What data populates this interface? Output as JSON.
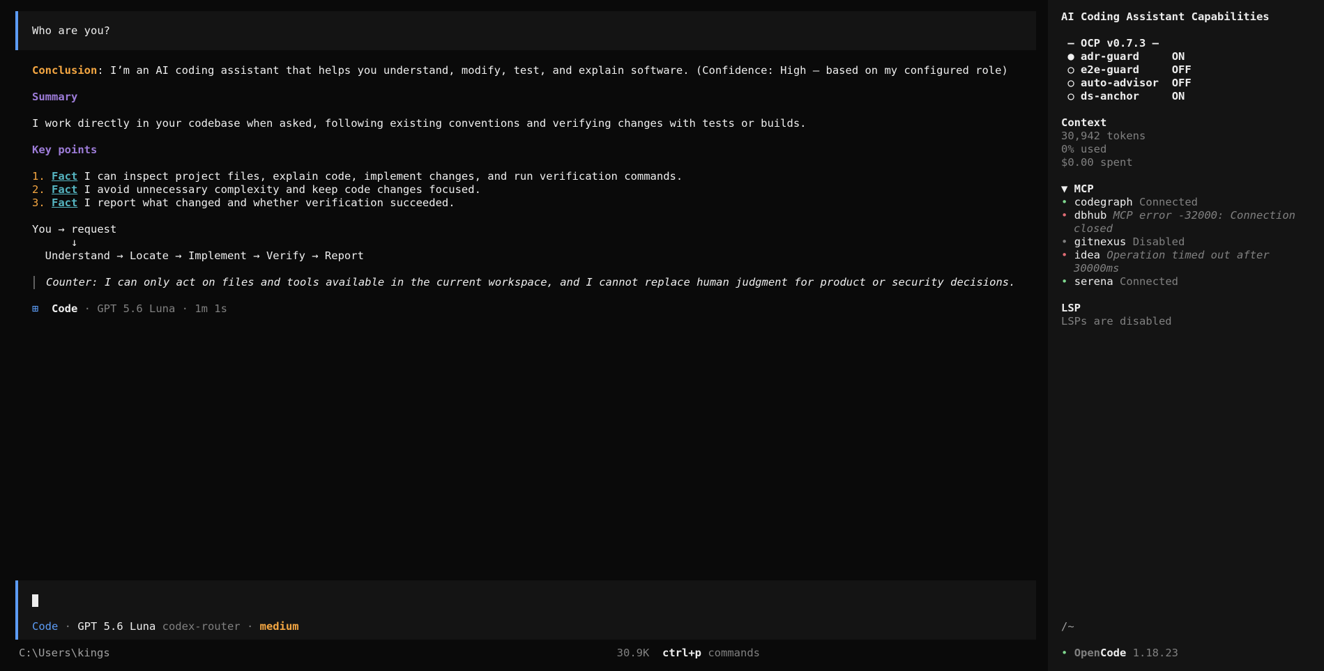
{
  "user_message": "Who are you?",
  "response": {
    "conclusion_label": "Conclusion",
    "conclusion_text": ": I’m an AI coding assistant that helps you understand, modify, test, and explain software. (Confidence: High — based on my configured role)",
    "summary_heading": "Summary",
    "summary_text": "I work directly in your codebase when asked, following existing conventions and verifying changes with tests or builds.",
    "key_points_heading": "Key points",
    "points": [
      {
        "num": "1.",
        "tag": "Fact",
        "text": " I can inspect project files, explain code, implement changes, and run verification commands."
      },
      {
        "num": "2.",
        "tag": "Fact",
        "text": " I avoid unnecessary complexity and keep code changes focused."
      },
      {
        "num": "3.",
        "tag": "Fact",
        "text": " I report what changed and whether verification succeeded."
      }
    ],
    "flow_line1": "You → request",
    "flow_line2": "      ↓",
    "flow_line3": "  Understand → Locate → Implement → Verify → Report",
    "counter": "Counter: I can only act on files and tools available in the current workspace, and I cannot replace human judgment for product or security decisions.",
    "meta_icon": "⊞",
    "meta_mode": "Code",
    "meta_detail": " · GPT 5.6 Luna · 1m 1s"
  },
  "prompt": {
    "mode": "Code",
    "sep1": " · ",
    "model": "GPT 5.6 Luna",
    "provider": " codex-router",
    "sep2": " · ",
    "effort": "medium"
  },
  "footer": {
    "path": "C:\\Users\\kings",
    "tokens": "30.9K",
    "shortcut": "ctrl+p",
    "shortcut_label": " commands"
  },
  "sidebar": {
    "title": "AI Coding Assistant Capabilities",
    "ocp_header": " — OCP v0.7.3 —",
    "ocp_items": [
      {
        "bullet": "●",
        "name": "adr-guard     ",
        "state": "ON"
      },
      {
        "bullet": "○",
        "name": "e2e-guard     ",
        "state": "OFF"
      },
      {
        "bullet": "○",
        "name": "auto-advisor  ",
        "state": "OFF"
      },
      {
        "bullet": "○",
        "name": "ds-anchor     ",
        "state": "ON"
      }
    ],
    "context_heading": "Context",
    "context_tokens": "30,942 tokens",
    "context_used": "0% used",
    "context_spent": "$0.00 spent",
    "mcp_heading": "▼ MCP",
    "mcp_items": [
      {
        "name": "codegraph",
        "status": "Connected",
        "color": "#7fd88f"
      },
      {
        "name": "dbhub",
        "status": "MCP error -32000: Connection",
        "status2": "closed",
        "color": "#e06c75"
      },
      {
        "name": "gitnexus",
        "status": "Disabled",
        "color": "#808080"
      },
      {
        "name": "idea",
        "status": "Operation timed out after",
        "status2": "30000ms",
        "color": "#e06c75"
      },
      {
        "name": "serena",
        "status": "Connected",
        "color": "#7fd88f"
      }
    ],
    "lsp_heading": "LSP",
    "lsp_text": "LSPs are disabled",
    "cwd": "/~",
    "app_open": "Open",
    "app_code": "Code",
    "version": " 1.18.23"
  },
  "colors": {
    "accent": "#5c9cf5",
    "orange": "#f5a742",
    "purple": "#9d7cd8",
    "teal": "#56b6c2",
    "green": "#7fd88f",
    "red": "#e06c75"
  }
}
